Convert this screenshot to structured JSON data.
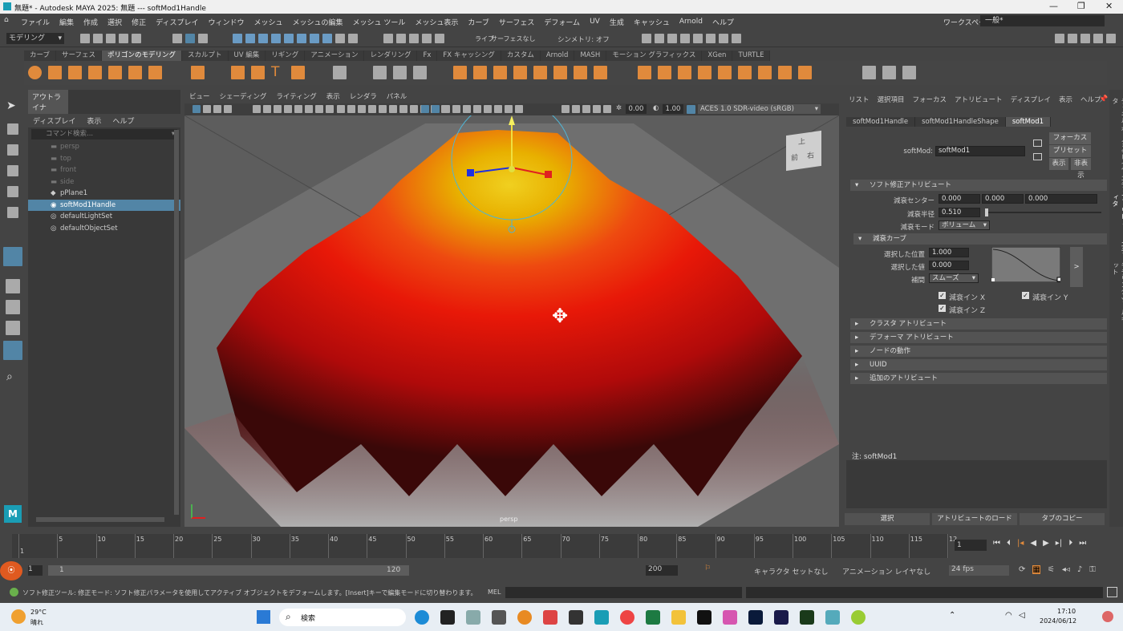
{
  "window": {
    "title": "無題* - Autodesk MAYA 2025: 無題   ---   softMod1Handle"
  },
  "menubar": [
    "ファイル",
    "編集",
    "作成",
    "選択",
    "修正",
    "ディスプレイ",
    "ウィンドウ",
    "メッシュ",
    "メッシュの編集",
    "メッシュ ツール",
    "メッシュ表示",
    "カーブ",
    "サーフェス",
    "デフォーム",
    "UV",
    "生成",
    "キャッシュ",
    "Arnold",
    "ヘルプ"
  ],
  "workspace": {
    "label": "ワークスペース :",
    "value": "一般*"
  },
  "statusline": {
    "mode": "モデリング",
    "live": "ライブ",
    "surface": "サーフェスなし",
    "symmetry": "シンメトリ: オフ"
  },
  "shelf_tabs": [
    "カーブ",
    "サーフェス",
    "ポリゴンのモデリング",
    "スカルプト",
    "UV 編集",
    "リギング",
    "アニメーション",
    "レンダリング",
    "Fx",
    "FX キャッシング",
    "カスタム",
    "Arnold",
    "MASH",
    "モーション グラフィックス",
    "XGen",
    "TURTLE"
  ],
  "shelf_active": "ポリゴンのモデリング",
  "outliner": {
    "title": "アウトライナ",
    "menu": [
      "ディスプレイ",
      "表示",
      "ヘルプ"
    ],
    "search_placeholder": "コマンド検索...",
    "items": [
      {
        "name": "persp",
        "dim": true
      },
      {
        "name": "top",
        "dim": true
      },
      {
        "name": "front",
        "dim": true
      },
      {
        "name": "side",
        "dim": true
      },
      {
        "name": "pPlane1",
        "dim": false
      },
      {
        "name": "softMod1Handle",
        "dim": false,
        "selected": true
      },
      {
        "name": "defaultLightSet",
        "dim": false
      },
      {
        "name": "defaultObjectSet",
        "dim": false
      }
    ]
  },
  "viewport": {
    "menu": [
      "ビュー",
      "シェーディング",
      "ライティング",
      "表示",
      "レンダラ",
      "パネル"
    ],
    "exposure": "0.00",
    "gamma": "1.00",
    "colorspace": "ACES 1.0 SDR-video (sRGB)",
    "camera_label": "persp",
    "viewcube": {
      "top": "上",
      "front": "前",
      "right": "右"
    }
  },
  "attribute_editor": {
    "menu": [
      "リスト",
      "選択項目",
      "フォーカス",
      "アトリビュート",
      "ディスプレイ",
      "表示",
      "ヘルプ"
    ],
    "tabs": [
      "softMod1Handle",
      "softMod1HandleShape",
      "softMod1"
    ],
    "active_tab": "softMod1",
    "node_label": "softMod:",
    "node_value": "softMod1",
    "focus_btn": "フォーカス",
    "preset_btn": "プリセット",
    "show_btn": "表示",
    "hide_btn": "非表示",
    "section_softmod": "ソフト修正アトリビュート",
    "falloff_center_label": "減衰センター",
    "falloff_center": [
      "0.000",
      "0.000",
      "0.000"
    ],
    "falloff_radius_label": "減衰半径",
    "falloff_radius": "0.510",
    "falloff_mode_label": "減衰モード",
    "falloff_mode": "ボリューム",
    "section_curve": "減衰カーブ",
    "selected_pos_label": "選択した位置",
    "selected_pos": "1.000",
    "selected_val_label": "選択した値",
    "selected_val": "0.000",
    "interp_label": "補間",
    "interp": "スムーズ",
    "falloff_in_x": "減衰イン X",
    "falloff_in_y": "減衰イン Y",
    "falloff_in_z": "減衰イン Z",
    "collapsed_sections": [
      "クラスタ アトリビュート",
      "デフォーマ アトリビュート",
      "ノードの動作",
      "UUID",
      "追加のアトリビュート"
    ],
    "note_label": "注:  softMod1",
    "bottom_buttons": [
      "選択",
      "アトリビュートのロード",
      "タブのコピー"
    ],
    "side_tabs": [
      "チャネル ボックス/レイヤ エディタ",
      "アトリビュート エディタ",
      "モデリング ツールキット"
    ]
  },
  "timeline": {
    "ticks": [
      "1",
      "5",
      "10",
      "15",
      "20",
      "25",
      "30",
      "35",
      "40",
      "45",
      "50",
      "55",
      "60",
      "65",
      "70",
      "75",
      "80",
      "85",
      "90",
      "95",
      "100",
      "105",
      "110",
      "115",
      "12"
    ],
    "current": "1"
  },
  "range": {
    "start": "1",
    "inner_start": "1",
    "inner_end": "120",
    "end": "200",
    "character_set": "キャラクタ セットなし",
    "anim_layer": "アニメーション レイヤなし",
    "fps": "24 fps"
  },
  "helpline": {
    "text": "ソフト修正ツール: 修正モード: ソフト修正パラメータを使用してアクティブ オブジェクトをデフォームします。[Insert]キーで編集モードに切り替わります。",
    "mel": "MEL"
  },
  "taskbar": {
    "weather_temp": "29°C",
    "weather_desc": "晴れ",
    "search": "検索",
    "time": "17:10",
    "date": "2024/06/12"
  },
  "colors": {
    "selection": "#5285a6",
    "bg": "#444444",
    "mesh_top": "#e8c800",
    "mesh_body": "#dd1a10"
  }
}
